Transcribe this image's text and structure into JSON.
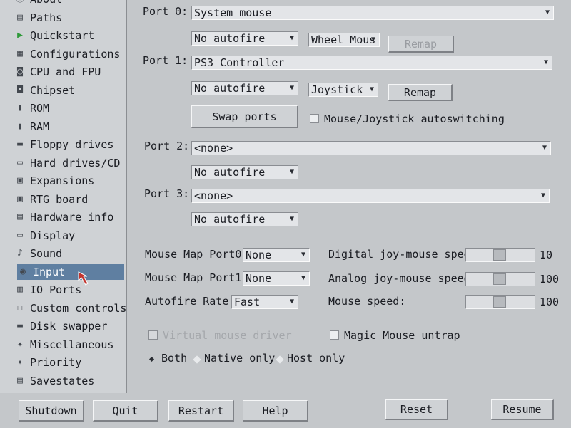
{
  "sidebar": {
    "items": [
      {
        "label": "About",
        "icon": "about-icon"
      },
      {
        "label": "Paths",
        "icon": "paths-icon"
      },
      {
        "label": "Quickstart",
        "icon": "play-icon"
      },
      {
        "label": "Configurations",
        "icon": "config-icon"
      },
      {
        "label": "CPU and FPU",
        "icon": "cpu-icon"
      },
      {
        "label": "Chipset",
        "icon": "chipset-icon"
      },
      {
        "label": "ROM",
        "icon": "rom-icon"
      },
      {
        "label": "RAM",
        "icon": "ram-icon"
      },
      {
        "label": "Floppy drives",
        "icon": "floppy-icon"
      },
      {
        "label": "Hard drives/CD",
        "icon": "harddrive-icon"
      },
      {
        "label": "Expansions",
        "icon": "expansion-icon"
      },
      {
        "label": "RTG board",
        "icon": "rtg-icon"
      },
      {
        "label": "Hardware info",
        "icon": "hardware-icon"
      },
      {
        "label": "Display",
        "icon": "display-icon"
      },
      {
        "label": "Sound",
        "icon": "sound-icon"
      },
      {
        "label": "Input",
        "icon": "input-icon"
      },
      {
        "label": "IO Ports",
        "icon": "ioports-icon"
      },
      {
        "label": "Custom controls",
        "icon": "controls-icon"
      },
      {
        "label": "Disk swapper",
        "icon": "disk-icon"
      },
      {
        "label": "Miscellaneous",
        "icon": "misc-icon"
      },
      {
        "label": "Priority",
        "icon": "priority-icon"
      },
      {
        "label": "Savestates",
        "icon": "savestate-icon"
      }
    ],
    "active": "Input"
  },
  "ports": {
    "port0": {
      "label": "Port 0:",
      "device": "System mouse",
      "autofire": "No autofire",
      "mode": "Wheel Mous",
      "remap": "Remap"
    },
    "port1": {
      "label": "Port 1:",
      "device": "PS3 Controller",
      "autofire": "No autofire",
      "mode": "Joystick",
      "remap": "Remap"
    },
    "swap": "Swap ports",
    "autoswitch": "Mouse/Joystick autoswitching",
    "port2": {
      "label": "Port 2:",
      "device": "<none>",
      "autofire": "No autofire"
    },
    "port3": {
      "label": "Port 3:",
      "device": "<none>",
      "autofire": "No autofire"
    }
  },
  "mouse": {
    "map0_label": "Mouse Map Port0:",
    "map0_value": "None",
    "map1_label": "Mouse Map Port1:",
    "map1_value": "None",
    "autofire_rate_label": "Autofire Rate:",
    "autofire_rate_value": "Fast",
    "digital_label": "Digital joy-mouse speed:",
    "digital_value": "10",
    "analog_label": "Analog joy-mouse speed:",
    "analog_value": "100",
    "mouse_speed_label": "Mouse speed:",
    "mouse_speed_value": "100",
    "virtual_driver": "Virtual mouse driver",
    "magic_untrap": "Magic Mouse untrap",
    "radio": {
      "both": "Both",
      "native": "Native only",
      "host": "Host only",
      "selected": "Both"
    }
  },
  "buttons": {
    "shutdown": "Shutdown",
    "quit": "Quit",
    "restart": "Restart",
    "help": "Help",
    "reset": "Reset",
    "resume": "Resume"
  },
  "colors": {
    "panel": "#c4c7ca",
    "sidebar": "#cfd2d5",
    "active": "#5f7fa1"
  }
}
